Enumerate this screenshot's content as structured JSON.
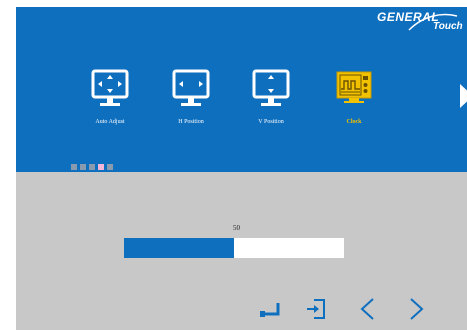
{
  "brand": {
    "name_main": "GENERAL",
    "name_sub": "Touch"
  },
  "menu": {
    "items": [
      {
        "label": "Auto Adjust",
        "icon": "auto-adjust-icon",
        "active": false
      },
      {
        "label": "H Position",
        "icon": "h-position-icon",
        "active": false
      },
      {
        "label": "V Position",
        "icon": "v-position-icon",
        "active": false
      },
      {
        "label": "Clock",
        "icon": "clock-icon",
        "active": true
      }
    ],
    "next_icon": "chevron-right-icon"
  },
  "pager": {
    "total": 5,
    "current": 4
  },
  "adjust": {
    "value": "50",
    "fraction": 0.5
  },
  "controls": {
    "enter_icon": "enter-icon",
    "exit_icon": "exit-icon",
    "prev_icon": "chevron-left-icon",
    "next_icon": "chevron-right-icon"
  },
  "colors": {
    "panel_blue": "#0f6fbf",
    "panel_gray": "#c8c8c8",
    "active_label": "#f2c200",
    "active_dot": "#f4b6d6"
  }
}
